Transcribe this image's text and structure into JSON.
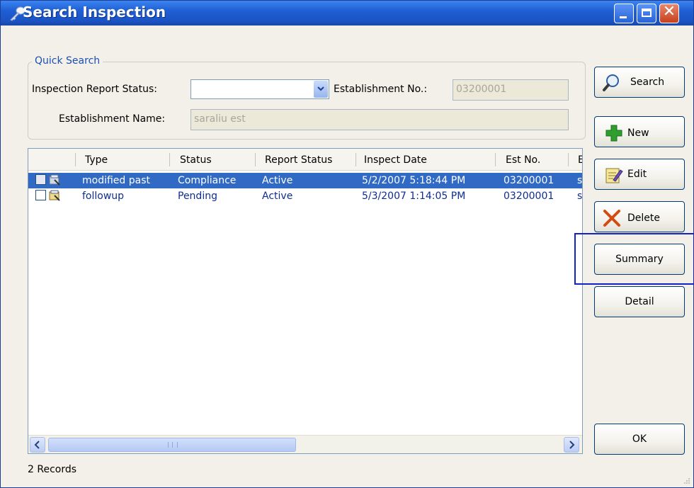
{
  "window": {
    "title": "Search Inspection"
  },
  "quick_search": {
    "legend": "Quick Search",
    "report_status_label": "Inspection Report Status:",
    "report_status_value": "",
    "establishment_no_label": "Establishment No.:",
    "establishment_no_value": "03200001",
    "establishment_name_label": "Establishment Name:",
    "establishment_name_value": "saraliu est"
  },
  "table": {
    "columns": [
      "Type",
      "Status",
      "Report Status",
      "Inspect Date",
      "Est No.",
      "E"
    ],
    "rows": [
      {
        "type": "modified past",
        "status": "Compliance",
        "report_status": "Active",
        "inspect_date": "5/2/2007 5:18:44 PM",
        "est_no": "03200001",
        "extra": "sa",
        "selected": true
      },
      {
        "type": "followup",
        "status": "Pending",
        "report_status": "Active",
        "inspect_date": "5/3/2007 1:14:05 PM",
        "est_no": "03200001",
        "extra": "sa",
        "selected": false
      }
    ]
  },
  "buttons": {
    "search": "Search",
    "new": "New",
    "edit": "Edit",
    "delete": "Delete",
    "summary": "Summary",
    "detail": "Detail",
    "ok": "OK"
  },
  "status_bar": {
    "records": "2 Records"
  },
  "icons": {
    "title": "key-icon",
    "search": "magnifier-icon",
    "new": "plus-icon",
    "edit": "edit-icon",
    "delete": "delete-x-icon"
  },
  "colors": {
    "title_bar": "#1f5fd4",
    "selection": "#316ac5",
    "highlight_box": "#1123c7"
  }
}
